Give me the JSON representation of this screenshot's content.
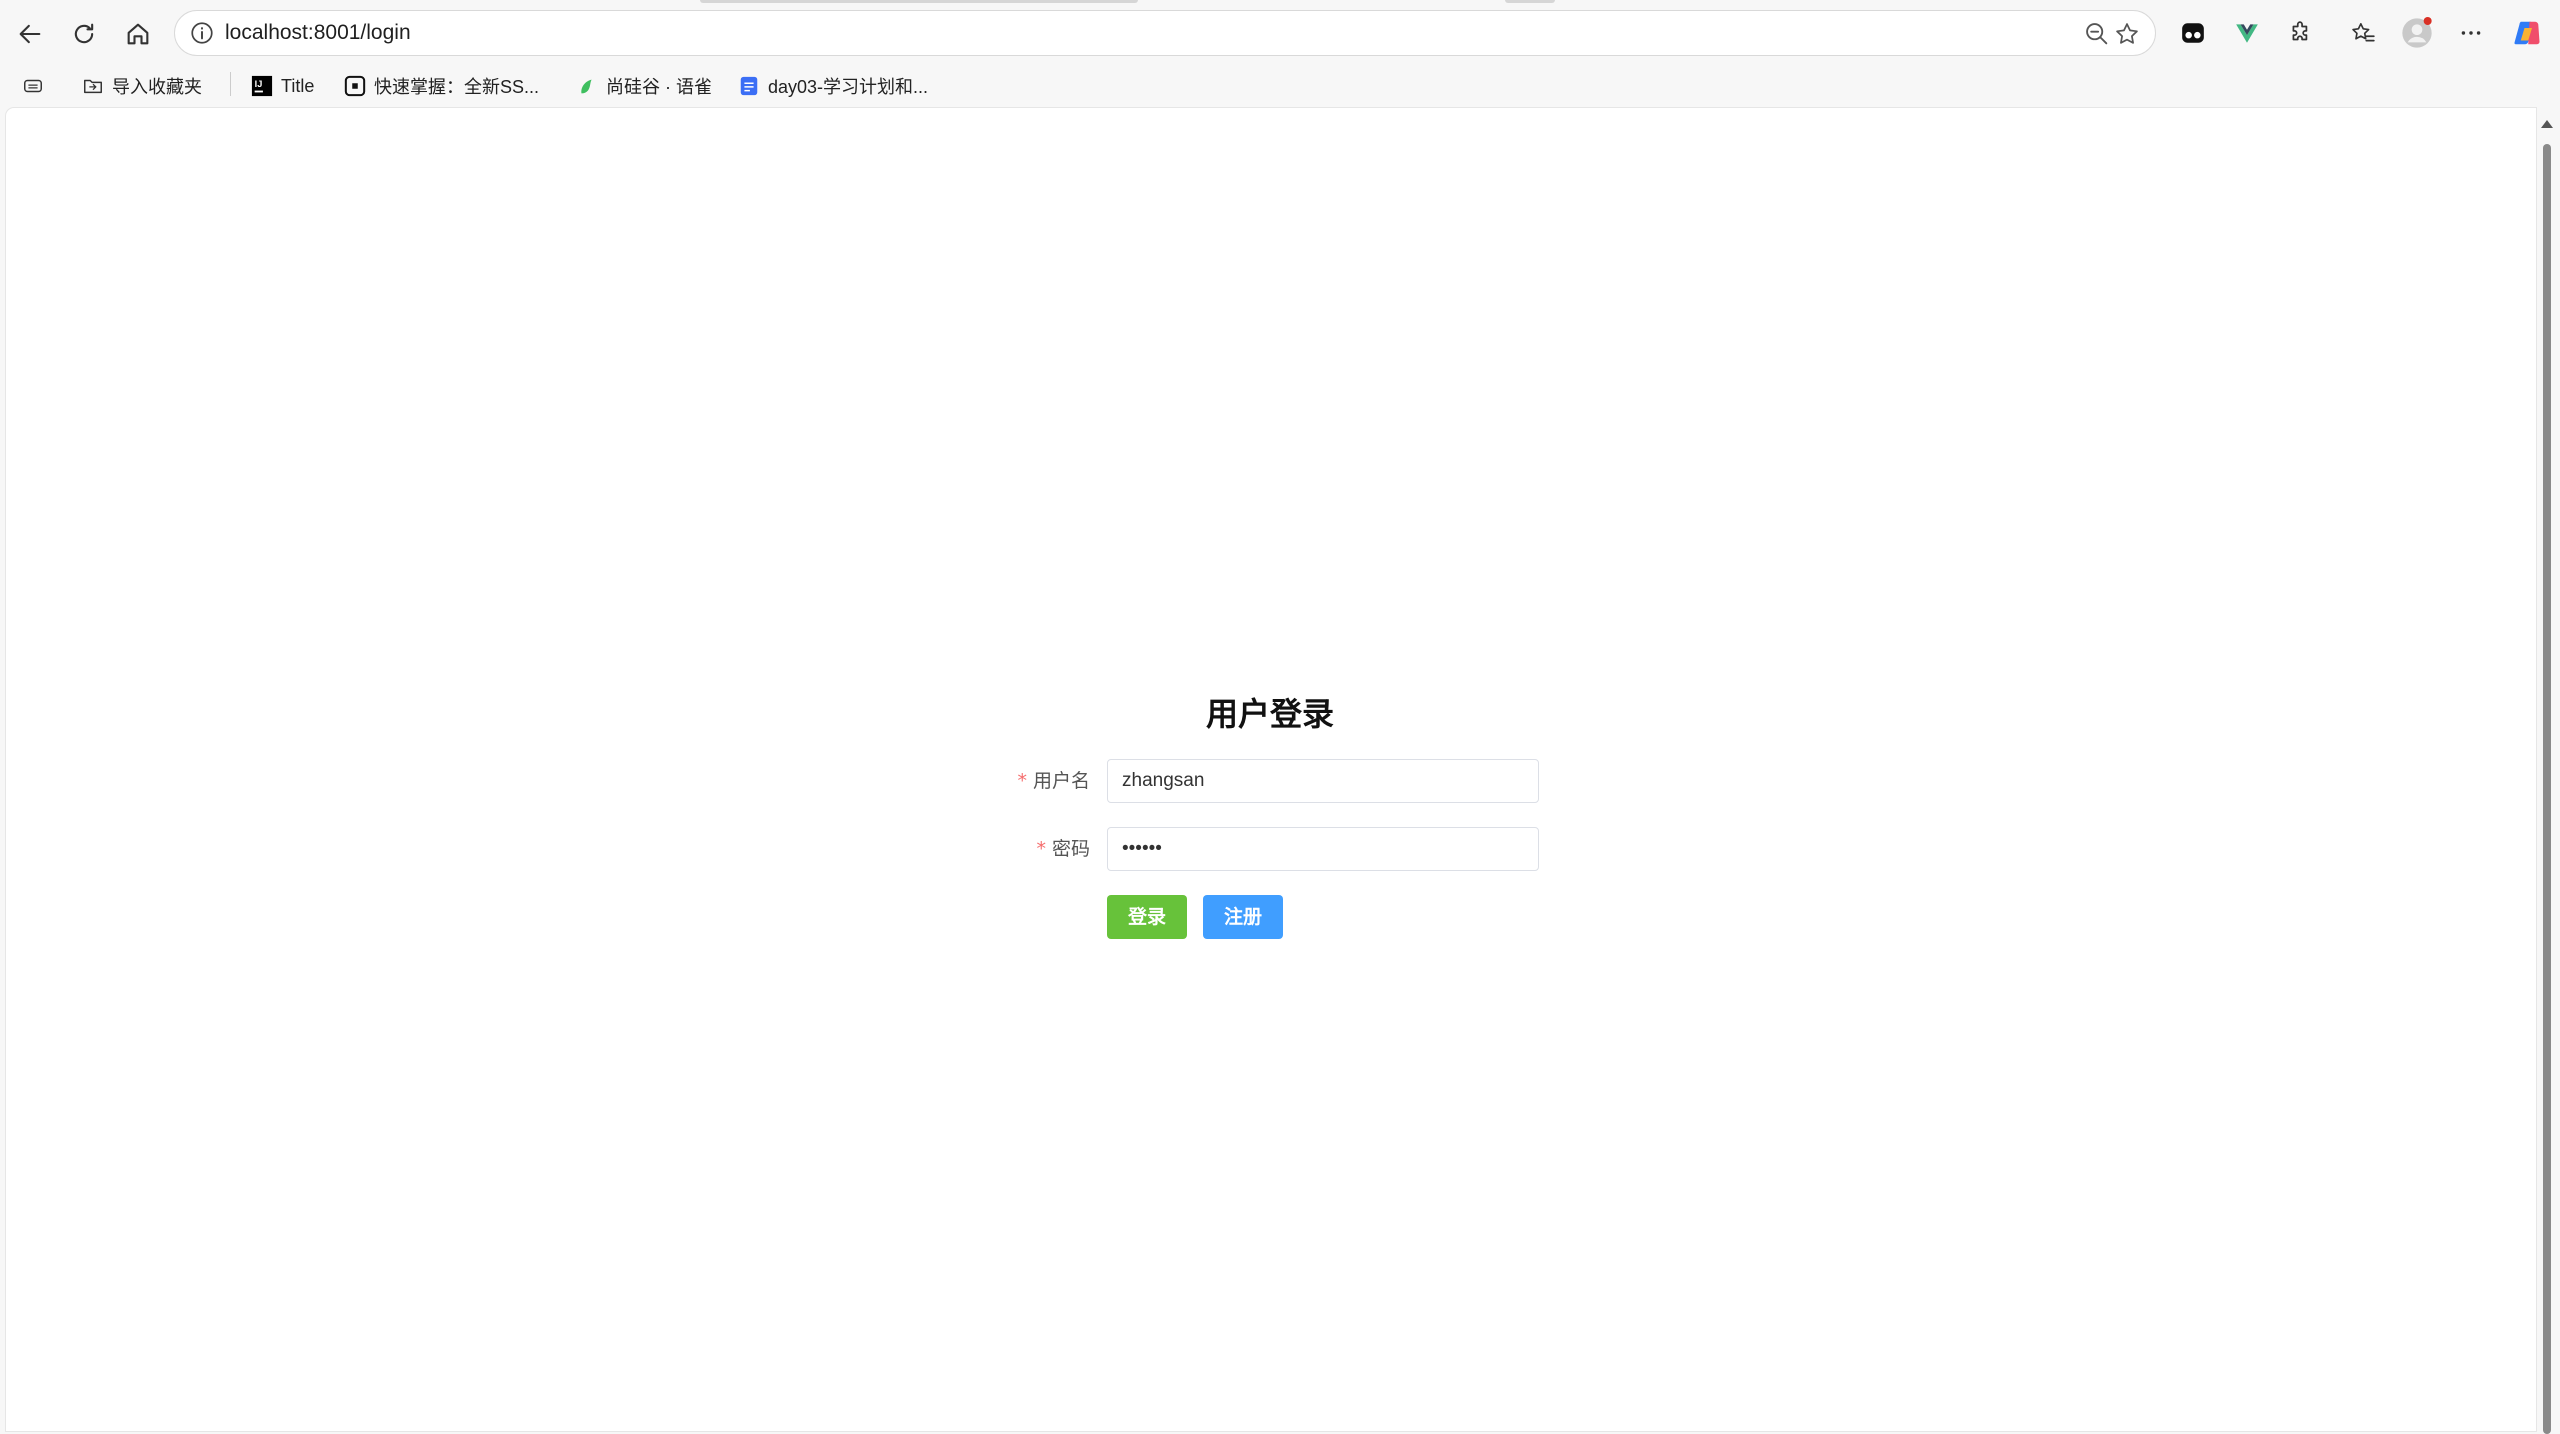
{
  "browser": {
    "url": "localhost:8001/login",
    "bookmarks": [
      {
        "label": "导入收藏夹",
        "icon": "import-folder-icon"
      },
      {
        "label": "Title",
        "icon": "intellij-icon"
      },
      {
        "label": "快速掌握：全新SS...",
        "icon": "notion-icon"
      },
      {
        "label": "尚硅谷 · 语雀",
        "icon": "yuque-icon"
      },
      {
        "label": "day03-学习计划和...",
        "icon": "doc-icon"
      }
    ]
  },
  "login": {
    "title": "用户登录",
    "username_label": "用户名",
    "username_value": "zhangsan",
    "password_label": "密码",
    "password_value": "••••••",
    "required_mark": "*",
    "login_button": "登录",
    "register_button": "注册"
  },
  "colors": {
    "login_button": "#67c23a",
    "register_button": "#409eff",
    "required": "#f56c6c"
  }
}
